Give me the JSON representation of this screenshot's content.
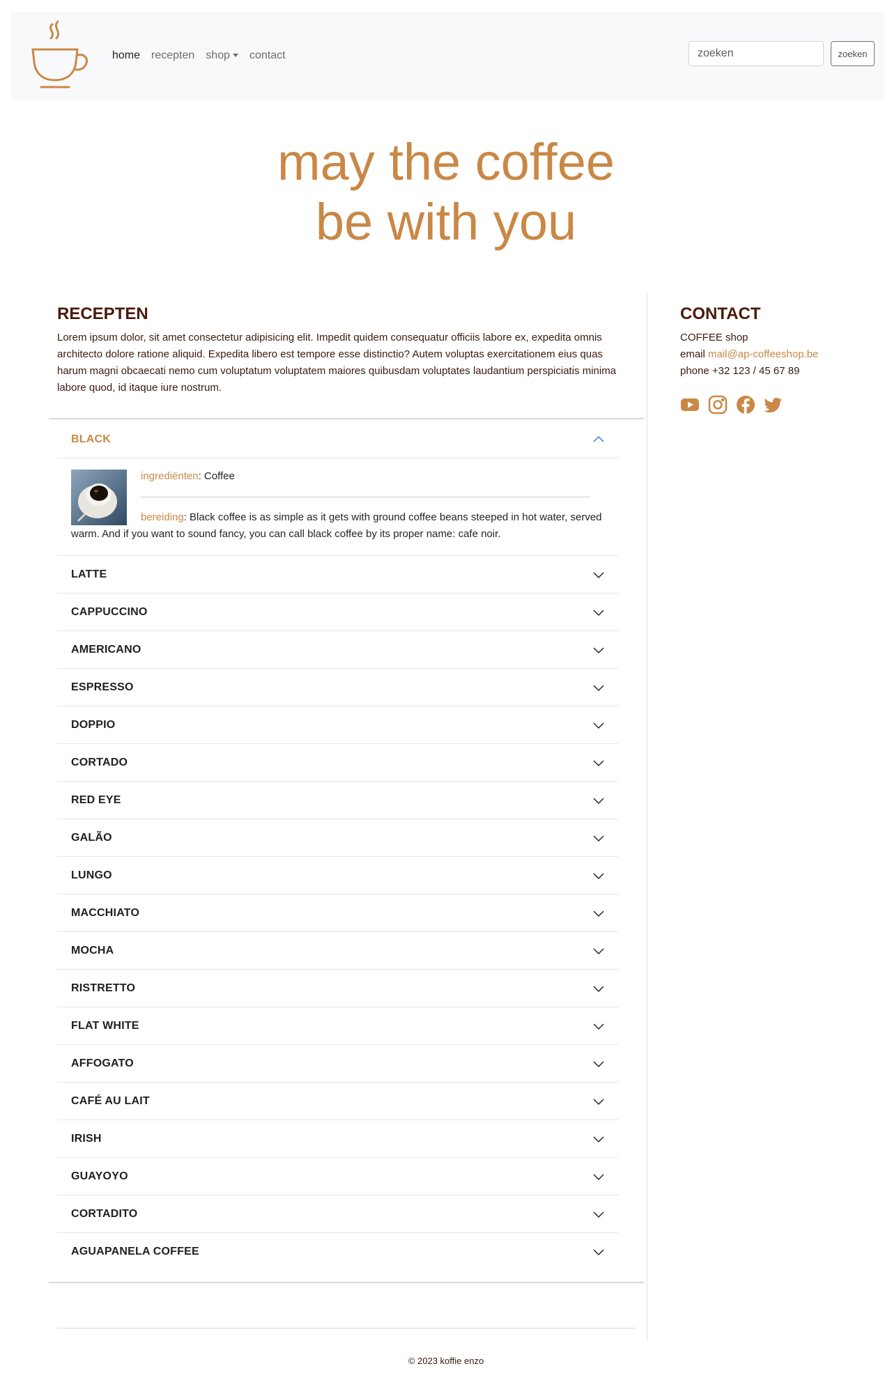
{
  "colors": {
    "accent": "#c98846",
    "heading": "#4a1a0a",
    "navbar_bg": "#f8f9fa"
  },
  "nav": {
    "logo_icon": "coffee-cup-icon",
    "links": [
      {
        "label": "home",
        "active": true
      },
      {
        "label": "recepten",
        "active": false
      },
      {
        "label": "shop",
        "active": false,
        "dropdown": true
      },
      {
        "label": "contact",
        "active": false
      }
    ],
    "search_placeholder": "zoeken",
    "search_button": "zoeken"
  },
  "hero": {
    "line1": "may the coffee",
    "line2": "be with you"
  },
  "recepten": {
    "title": "RECEPTEN",
    "intro": "Lorem ipsum dolor, sit amet consectetur adipisicing elit. Impedit quidem consequatur officiis labore ex, expedita omnis architecto dolore ratione aliquid. Expedita libero est tempore esse distinctio? Autem voluptas exercitationem eius quas harum magni obcaecati nemo cum voluptatum voluptatem maiores quibusdam voluptates laudantium perspiciatis minima labore quod, id itaque iure nostrum."
  },
  "contact": {
    "title": "CONTACT",
    "company": "COFFEE shop",
    "email_label": "email ",
    "email": "mail@ap-coffeeshop.be",
    "phone": "phone +32 123 / 45 67 89",
    "socials": [
      "youtube-icon",
      "instagram-icon",
      "facebook-icon",
      "twitter-icon"
    ]
  },
  "accordion": {
    "open_item": {
      "title": "BLACK",
      "image_icon": "black-coffee-cup-photo",
      "ingredients_label": "ingrediënten",
      "ingredients": ": Coffee",
      "preparation_label": "bereiding",
      "preparation": ": Black coffee is as simple as it gets with ground coffee beans steeped in hot water, served warm. And if you want to sound fancy, you can call black coffee by its proper name: cafe noir."
    },
    "items": [
      "LATTE",
      "CAPPUCCINO",
      "AMERICANO",
      "ESPRESSO",
      "DOPPIO",
      "CORTADO",
      "RED EYE",
      "GALÃO",
      "LUNGO",
      "MACCHIATO",
      "MOCHA",
      "RISTRETTO",
      "FLAT WHITE",
      "AFFOGATO",
      "CAFÉ AU LAIT",
      "IRISH",
      "GUAYOYO",
      "CORTADITO",
      "AGUAPANELA COFFEE"
    ]
  },
  "footer": {
    "text": "© 2023 koffie enzo"
  }
}
